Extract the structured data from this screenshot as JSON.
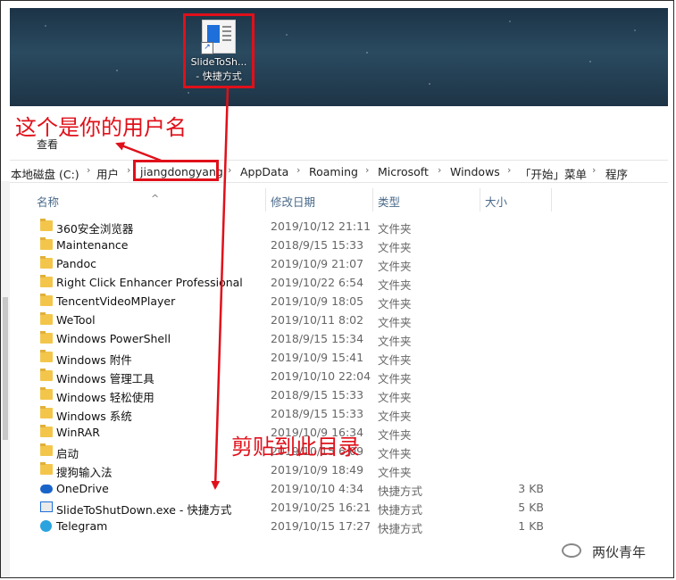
{
  "desktop": {
    "shortcut_name_line1": "SlideToSh...",
    "shortcut_name_line2": "- 快捷方式"
  },
  "annotations": {
    "username_note": "这个是你的用户名",
    "paste_note": "剪贴到此目录",
    "color": "#e0101a"
  },
  "ribbon": {
    "view_tab": "查看"
  },
  "address_bar": {
    "crumbs": [
      "本地磁盘 (C:)",
      "用户",
      "jiangdongyang",
      "AppData",
      "Roaming",
      "Microsoft",
      "Windows",
      "「开始」菜单",
      "程序"
    ]
  },
  "columns": {
    "name": "名称",
    "modified": "修改日期",
    "type": "类型",
    "size": "大小"
  },
  "files": [
    {
      "name": "360安全浏览器",
      "date": "2019/10/12 21:11",
      "type": "文件夹",
      "size": "",
      "icon": "folder-icon"
    },
    {
      "name": "Maintenance",
      "date": "2018/9/15 15:33",
      "type": "文件夹",
      "size": "",
      "icon": "folder-icon"
    },
    {
      "name": "Pandoc",
      "date": "2019/10/9 21:07",
      "type": "文件夹",
      "size": "",
      "icon": "folder-icon"
    },
    {
      "name": "Right Click Enhancer Professional",
      "date": "2019/10/22 6:54",
      "type": "文件夹",
      "size": "",
      "icon": "folder-icon"
    },
    {
      "name": "TencentVideoMPlayer",
      "date": "2019/10/9 18:05",
      "type": "文件夹",
      "size": "",
      "icon": "folder-icon"
    },
    {
      "name": "WeTool",
      "date": "2019/10/11 8:02",
      "type": "文件夹",
      "size": "",
      "icon": "folder-icon"
    },
    {
      "name": "Windows PowerShell",
      "date": "2018/9/15 15:34",
      "type": "文件夹",
      "size": "",
      "icon": "folder-icon"
    },
    {
      "name": "Windows 附件",
      "date": "2019/10/9 15:41",
      "type": "文件夹",
      "size": "",
      "icon": "folder-icon"
    },
    {
      "name": "Windows 管理工具",
      "date": "2019/10/10 22:04",
      "type": "文件夹",
      "size": "",
      "icon": "folder-icon"
    },
    {
      "name": "Windows 轻松使用",
      "date": "2018/9/15 15:33",
      "type": "文件夹",
      "size": "",
      "icon": "folder-icon"
    },
    {
      "name": "Windows 系统",
      "date": "2018/9/15 15:33",
      "type": "文件夹",
      "size": "",
      "icon": "folder-icon"
    },
    {
      "name": "WinRAR",
      "date": "2019/10/9 16:34",
      "type": "文件夹",
      "size": "",
      "icon": "folder-icon"
    },
    {
      "name": "启动",
      "date": "2019/10/15 6:09",
      "type": "文件夹",
      "size": "",
      "icon": "folder-icon"
    },
    {
      "name": "搜狗输入法",
      "date": "2019/10/9 18:49",
      "type": "文件夹",
      "size": "",
      "icon": "folder-icon"
    },
    {
      "name": "OneDrive",
      "date": "2019/10/10 4:34",
      "type": "快捷方式",
      "size": "3 KB",
      "icon": "onedrive-icon"
    },
    {
      "name": "SlideToShutDown.exe - 快捷方式",
      "date": "2019/10/25 16:21",
      "type": "快捷方式",
      "size": "5 KB",
      "icon": "exe-shortcut-icon"
    },
    {
      "name": "Telegram",
      "date": "2019/10/15 17:27",
      "type": "快捷方式",
      "size": "1 KB",
      "icon": "telegram-icon"
    }
  ],
  "watermark": {
    "text": "两伙青年"
  }
}
